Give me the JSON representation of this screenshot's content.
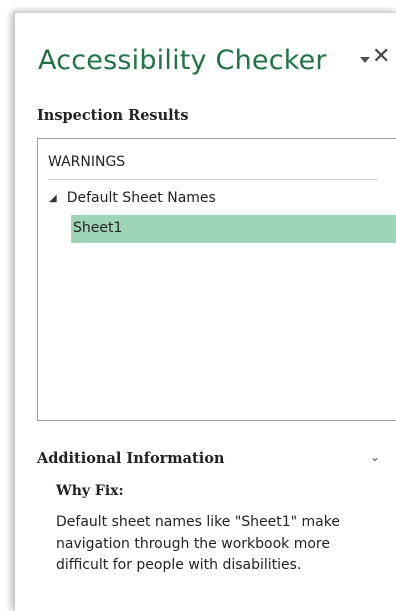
{
  "pane": {
    "title": "Accessibility Checker",
    "menu_icon": "dropdown-triangle",
    "close_icon": "close-x",
    "close_label": "✕"
  },
  "inspection": {
    "label": "Inspection Results",
    "group_header": "WARNINGS",
    "tree": {
      "node_label": "Default Sheet Names",
      "node_icon": "expanded-caret",
      "caret": "◢",
      "items": [
        {
          "label": "Sheet1",
          "selected": true
        }
      ]
    }
  },
  "additional_info": {
    "label": "Additional Information",
    "chevron": "⌄",
    "why_fix_title": "Why Fix:",
    "why_fix_text": "Default sheet names like \"Sheet1\" make navigation through the workbook more difficult for people with disabilities."
  },
  "colors": {
    "accent": "#217346",
    "selection": "#9fd5b7"
  }
}
